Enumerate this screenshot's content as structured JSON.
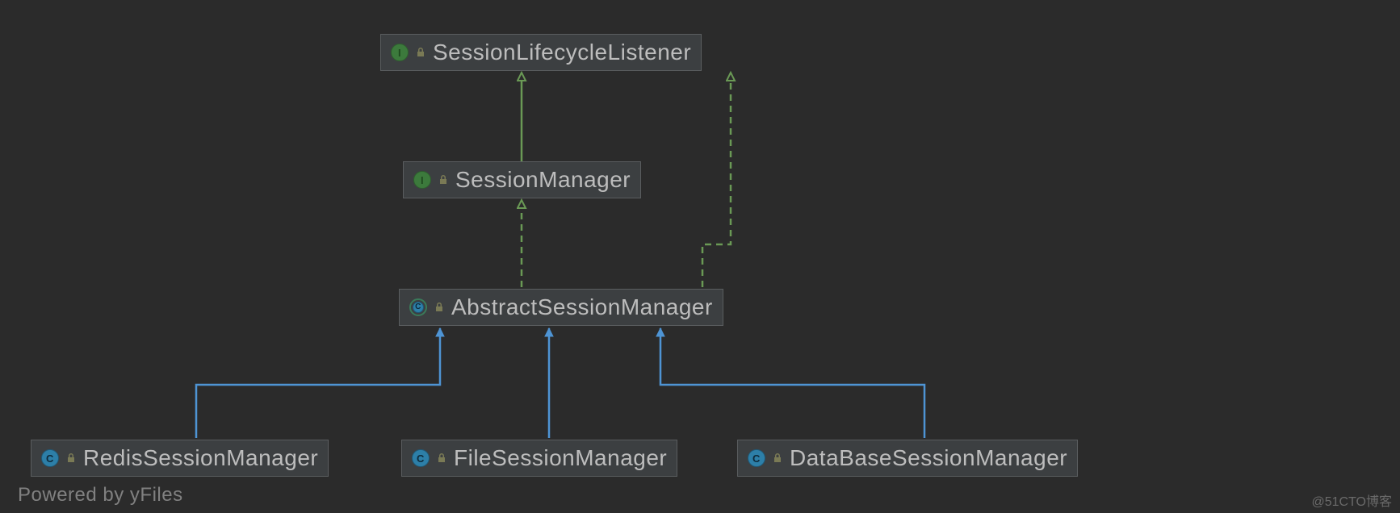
{
  "nodes": {
    "session_lifecycle_listener": {
      "kind": "I",
      "label": "SessionLifecycleListener"
    },
    "session_manager": {
      "kind": "I",
      "label": "SessionManager"
    },
    "abstract_session_manager": {
      "kind": "AC",
      "label": "AbstractSessionManager"
    },
    "redis_session_manager": {
      "kind": "C",
      "label": "RedisSessionManager"
    },
    "file_session_manager": {
      "kind": "C",
      "label": "FileSessionManager"
    },
    "database_session_manager": {
      "kind": "C",
      "label": "DataBaseSessionManager"
    }
  },
  "footer": {
    "left": "Powered by yFiles",
    "right": "@51CTO博客"
  },
  "colors": {
    "bg": "#2b2b2b",
    "node_bg": "#3c3f41",
    "node_border": "#5a5d5f",
    "text": "#bdbdbd",
    "green": "#6a9955",
    "blue": "#4e94d4"
  }
}
